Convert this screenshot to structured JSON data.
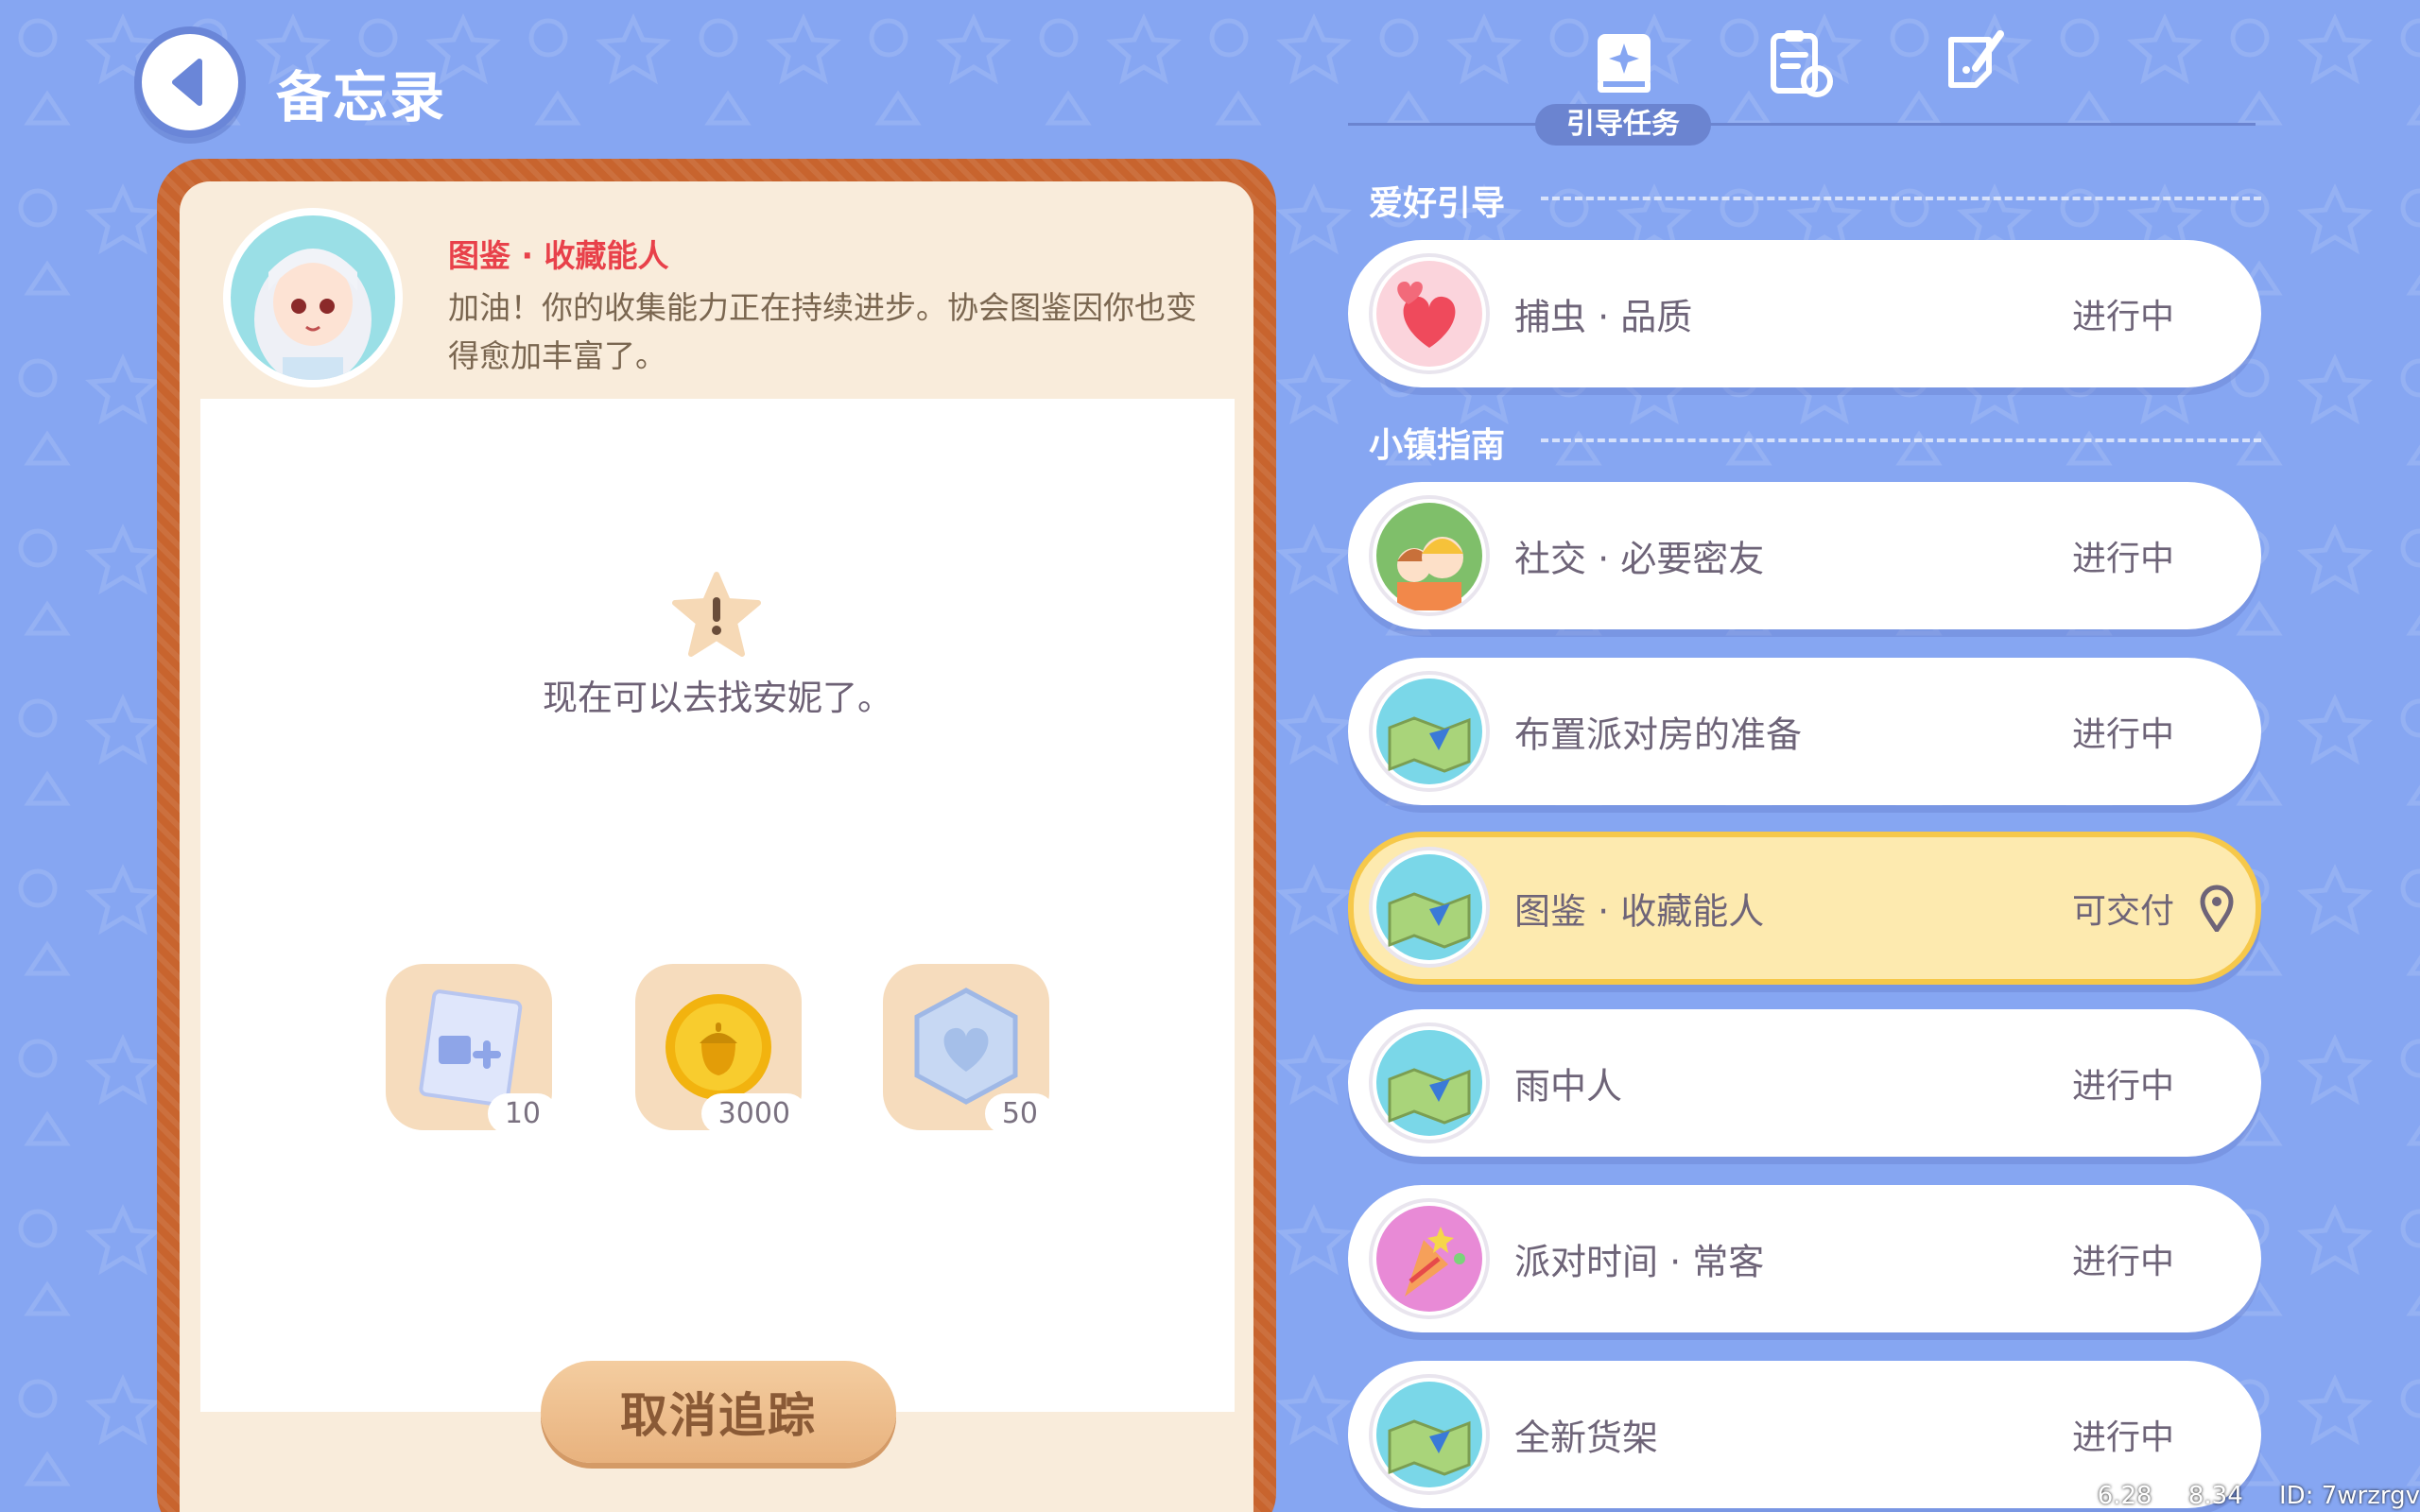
{
  "header": {
    "title": "备忘录"
  },
  "npc": {
    "name": "图鉴 · 收藏能人",
    "description": "加油！你的收集能力正在持续进步。协会图鉴因你也变得愈加丰富了。"
  },
  "task": {
    "text": "现在可以去找安妮了。",
    "rewards": [
      {
        "icon": "album-plus-icon",
        "count": "10"
      },
      {
        "icon": "acorn-coin-icon",
        "count": "3000"
      },
      {
        "icon": "heart-gem-icon",
        "count": "50"
      }
    ],
    "cancel_label": "取消追踪"
  },
  "tabs": {
    "active_label": "引导任务",
    "items": [
      "guide-book-icon",
      "clipboard-refresh-icon",
      "quill-note-icon"
    ]
  },
  "sections": [
    {
      "title": "爱好引导",
      "quests": [
        {
          "name": "捕虫 · 品质",
          "status": "进行中",
          "icon": "hearts-icon",
          "active": false
        }
      ]
    },
    {
      "title": "小镇指南",
      "quests": [
        {
          "name": "社交 · 必要密友",
          "status": "进行中",
          "icon": "friends-icon",
          "active": false
        },
        {
          "name": "布置派对房的准备",
          "status": "进行中",
          "icon": "map-icon",
          "active": false
        },
        {
          "name": "图鉴 · 收藏能人",
          "status": "可交付",
          "icon": "map-icon",
          "active": true
        },
        {
          "name": "雨中人",
          "status": "进行中",
          "icon": "map-icon",
          "active": false
        },
        {
          "name": "派对时间 · 常客",
          "status": "进行中",
          "icon": "party-popper-icon",
          "active": false
        },
        {
          "name": "全新货架",
          "status": "进行中",
          "icon": "map-icon",
          "active": false
        }
      ]
    }
  ],
  "footer": {
    "left": "6.28",
    "mid": "8.34",
    "id": "ID: 7wrzrgv"
  },
  "colors": {
    "background": "#86a6f2",
    "accent_red": "#e8414a",
    "active_quest": "#fdeaaf"
  }
}
